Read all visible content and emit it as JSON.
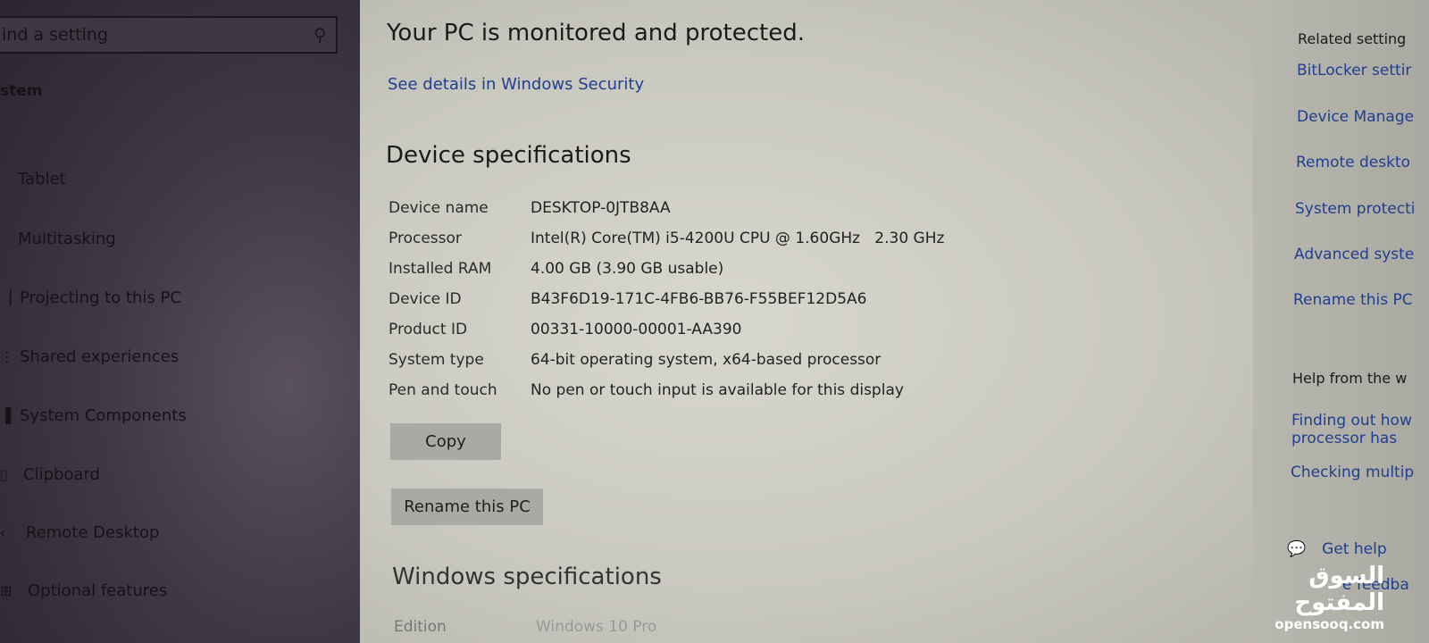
{
  "sidebar": {
    "search_placeholder": "ind a setting",
    "heading": "stem",
    "items": [
      {
        "label": "Tablet",
        "icon": "tablet-icon"
      },
      {
        "label": "Multitasking",
        "icon": "multitasking-icon"
      },
      {
        "label": "Projecting to this PC",
        "icon": "projecting-icon"
      },
      {
        "label": "Shared experiences",
        "icon": "shared-icon"
      },
      {
        "label": "System Components",
        "icon": "components-icon"
      },
      {
        "label": "Clipboard",
        "icon": "clipboard-icon"
      },
      {
        "label": "Remote Desktop",
        "icon": "remote-desktop-icon"
      },
      {
        "label": "Optional features",
        "icon": "optional-features-icon"
      }
    ]
  },
  "main": {
    "status": "Your PC is monitored and protected.",
    "security_link": "See details in Windows Security",
    "device_specs_title": "Device specifications",
    "specs": [
      {
        "label": "Device name",
        "value": "DESKTOP-0JTB8AA"
      },
      {
        "label": "Processor",
        "value": "Intel(R) Core(TM) i5-4200U CPU @ 1.60GHz   2.30 GHz"
      },
      {
        "label": "Installed RAM",
        "value": "4.00 GB (3.90 GB usable)"
      },
      {
        "label": "Device ID",
        "value": "B43F6D19-171C-4FB6-BB76-F55BEF12D5A6"
      },
      {
        "label": "Product ID",
        "value": "00331-10000-00001-AA390"
      },
      {
        "label": "System type",
        "value": "64-bit operating system, x64-based processor"
      },
      {
        "label": "Pen and touch",
        "value": "No pen or touch input is available for this display"
      }
    ],
    "copy_label": "Copy",
    "rename_label": "Rename this PC",
    "windows_specs_title": "Windows specifications",
    "edition_label": "Edition",
    "edition_value": "Windows 10 Pro"
  },
  "right": {
    "related_title": "Related setting",
    "related": [
      "BitLocker settir",
      "Device Manage",
      "Remote deskto",
      "System protecti",
      "Advanced syste",
      "Rename this PC"
    ],
    "help_title": "Help from the w",
    "help_links": [
      "Finding out how",
      "processor has",
      "Checking multip"
    ],
    "get_help": "Get help",
    "feedback": "e feedba"
  },
  "watermark": {
    "arabic": "السوق المفتوح",
    "latin": "opensooq.com"
  }
}
